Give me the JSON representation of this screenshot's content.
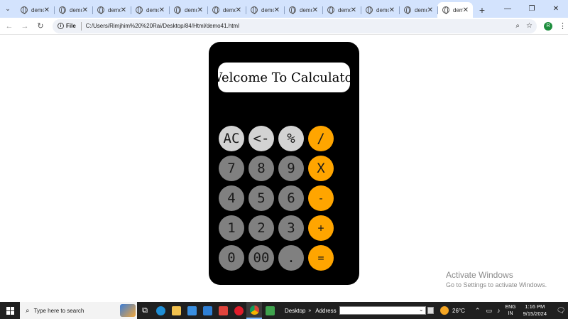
{
  "browser": {
    "tabs": [
      {
        "title": "demo"
      },
      {
        "title": "demo"
      },
      {
        "title": "demo"
      },
      {
        "title": "demo"
      },
      {
        "title": "demo"
      },
      {
        "title": "demo"
      },
      {
        "title": "demo"
      },
      {
        "title": "demo"
      },
      {
        "title": "demo"
      },
      {
        "title": "demo"
      },
      {
        "title": "demo"
      },
      {
        "title": "demo",
        "active": true
      }
    ],
    "new_tab_icon": "+",
    "url_scheme_label": "File",
    "url": "C:/Users/Rimjhim%20%20Rai/Desktop/84/Html/demo41.html",
    "profile_initial": "R",
    "window_controls": {
      "minimize": "—",
      "restore": "❐",
      "close": "✕"
    }
  },
  "calculator": {
    "display_text": "Welcome To Calculator",
    "colors": {
      "body": "#000000",
      "light_key": "#d3d3d3",
      "dark_key": "#808080",
      "operator_key": "#ffa500"
    },
    "keys": [
      {
        "label": "AC",
        "style": "light"
      },
      {
        "label": "<-",
        "style": "light"
      },
      {
        "label": "%",
        "style": "light"
      },
      {
        "label": "/",
        "style": "op"
      },
      {
        "label": "7",
        "style": "dark"
      },
      {
        "label": "8",
        "style": "dark"
      },
      {
        "label": "9",
        "style": "dark"
      },
      {
        "label": "X",
        "style": "op"
      },
      {
        "label": "4",
        "style": "dark"
      },
      {
        "label": "5",
        "style": "dark"
      },
      {
        "label": "6",
        "style": "dark"
      },
      {
        "label": "-",
        "style": "op"
      },
      {
        "label": "1",
        "style": "dark"
      },
      {
        "label": "2",
        "style": "dark"
      },
      {
        "label": "3",
        "style": "dark"
      },
      {
        "label": "+",
        "style": "op"
      },
      {
        "label": "0",
        "style": "dark"
      },
      {
        "label": "00",
        "style": "dark"
      },
      {
        "label": ".",
        "style": "dark"
      },
      {
        "label": "=",
        "style": "op"
      }
    ]
  },
  "watermark": {
    "title": "Activate Windows",
    "subtitle": "Go to Settings to activate Windows."
  },
  "taskbar": {
    "search_placeholder": "Type here to search",
    "toolbar_label": "Desktop",
    "address_label": "Address",
    "temperature": "26°C",
    "language": {
      "line1": "ENG",
      "line2": "IN"
    },
    "time": "1:16 PM",
    "date": "9/15/2024"
  }
}
